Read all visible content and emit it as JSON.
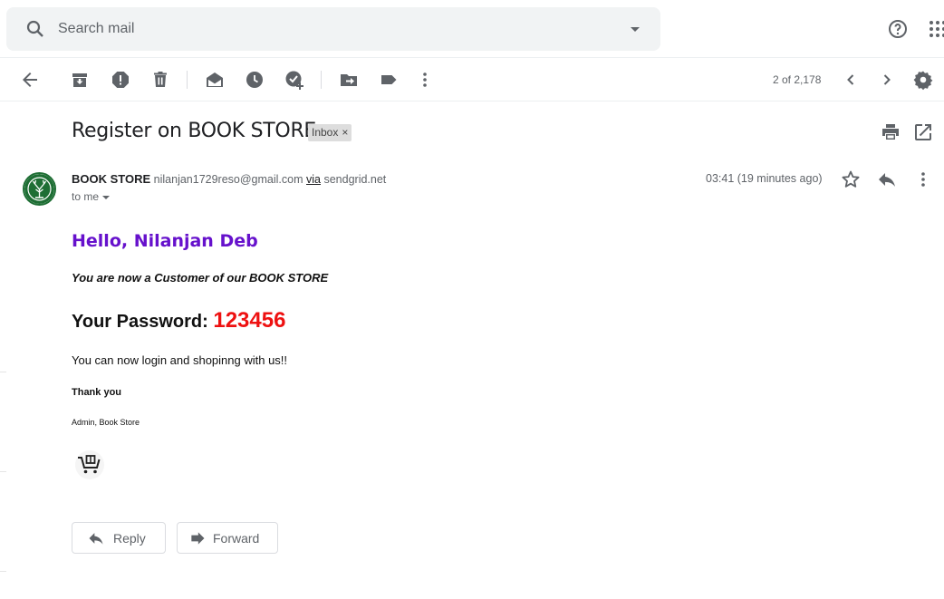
{
  "search": {
    "placeholder": "Search mail"
  },
  "toolbar": {
    "pager": "2 of 2,178"
  },
  "message": {
    "subject": "Register on BOOK STORE",
    "label": "Inbox",
    "label_close": "×",
    "sender_name": "BOOK STORE",
    "sender_email": "nilanjan1729reso@gmail.com",
    "via": "via",
    "via_domain": "sendgrid.net",
    "to": "to me",
    "time": "03:41 (19 minutes ago)"
  },
  "body": {
    "greeting": "Hello, Nilanjan Deb",
    "customer_line": "You are now a Customer of our BOOK STORE",
    "password_label": "Your Password:",
    "password_value": "123456",
    "login_line": "You can now login and shopinng with us!!",
    "thanks": "Thank you",
    "signature": "Admin, Book Store"
  },
  "actions": {
    "reply": "Reply",
    "forward": "Forward"
  },
  "colors": {
    "greeting": "#6611cc",
    "password": "#ee1111",
    "avatar_ring": "#1e6e34"
  },
  "icons": [
    "search-icon",
    "dropdown-icon",
    "help-icon",
    "apps-icon",
    "back-icon",
    "archive-icon",
    "report-spam-icon",
    "delete-icon",
    "mark-unread-icon",
    "snooze-icon",
    "add-task-icon",
    "move-to-icon",
    "label-icon",
    "more-icon",
    "prev-icon",
    "next-icon",
    "settings-icon",
    "print-icon",
    "open-new-window-icon",
    "star-icon",
    "reply-icon",
    "forward-icon",
    "cart-icon"
  ]
}
